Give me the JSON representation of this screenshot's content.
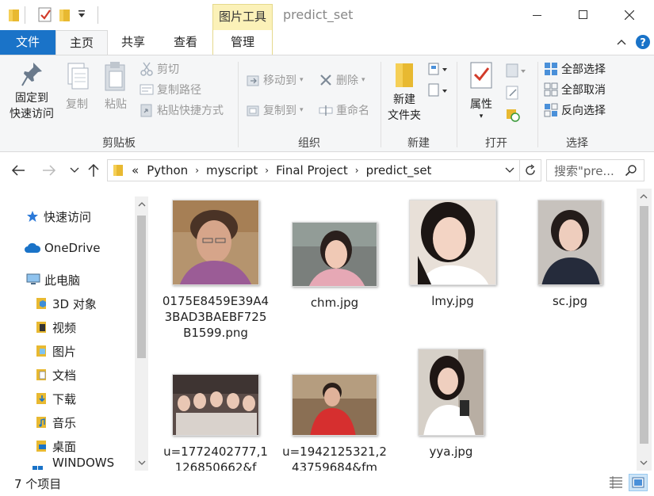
{
  "window": {
    "title": "predict_set",
    "context_tab": "图片工具",
    "minimize_icon": "minimize-icon",
    "maximize_icon": "maximize-icon",
    "close_icon": "close-icon"
  },
  "ribbon_tabs": {
    "file": "文件",
    "home": "主页",
    "share": "共享",
    "view": "查看",
    "manage": "管理"
  },
  "ribbon": {
    "clipboard": {
      "pin": "固定到",
      "pin2": "快速访问",
      "copy": "复制",
      "paste": "粘贴",
      "cut": "剪切",
      "copy_path": "复制路径",
      "paste_shortcut": "粘贴快捷方式",
      "label": "剪贴板"
    },
    "organize": {
      "move_to": "移动到",
      "copy_to": "复制到",
      "delete": "删除",
      "rename": "重命名",
      "label": "组织"
    },
    "new": {
      "new_folder": "新建",
      "new_folder2": "文件夹",
      "label": "新建"
    },
    "open": {
      "properties": "属性",
      "label": "打开"
    },
    "select": {
      "select_all": "全部选择",
      "select_none": "全部取消",
      "invert": "反向选择",
      "label": "选择"
    }
  },
  "address": {
    "prefix": "«",
    "crumbs": [
      "Python",
      "myscript",
      "Final Project",
      "predict_set"
    ],
    "search_placeholder": "搜索\"pre..."
  },
  "nav": {
    "items": [
      {
        "label": "快速访问",
        "icon": "star-icon"
      },
      {
        "label": "OneDrive",
        "icon": "cloud-icon"
      },
      {
        "label": "此电脑",
        "icon": "computer-icon"
      },
      {
        "label": "3D 对象",
        "icon": "folder-3d-icon"
      },
      {
        "label": "视频",
        "icon": "folder-video-icon"
      },
      {
        "label": "图片",
        "icon": "folder-pictures-icon"
      },
      {
        "label": "文档",
        "icon": "folder-documents-icon"
      },
      {
        "label": "下载",
        "icon": "folder-downloads-icon"
      },
      {
        "label": "音乐",
        "icon": "folder-music-icon"
      },
      {
        "label": "桌面",
        "icon": "folder-desktop-icon"
      },
      {
        "label": "WINDOWS (C:",
        "icon": "drive-icon"
      }
    ]
  },
  "files": [
    {
      "name": "0175E8459E39A43BAD3BAEBF725B1599.png"
    },
    {
      "name": "chm.jpg"
    },
    {
      "name": "lmy.jpg"
    },
    {
      "name": "sc.jpg"
    },
    {
      "name": "u=1772402777,1126850662&f"
    },
    {
      "name": "u=1942125321,243759684&fm"
    },
    {
      "name": "yya.jpg"
    }
  ],
  "status": {
    "count": "7 个项目"
  },
  "colors": {
    "accent": "#1a73c8",
    "context_tab_bg": "#fbf1b8",
    "ribbon_bg": "#f5f6f7"
  }
}
